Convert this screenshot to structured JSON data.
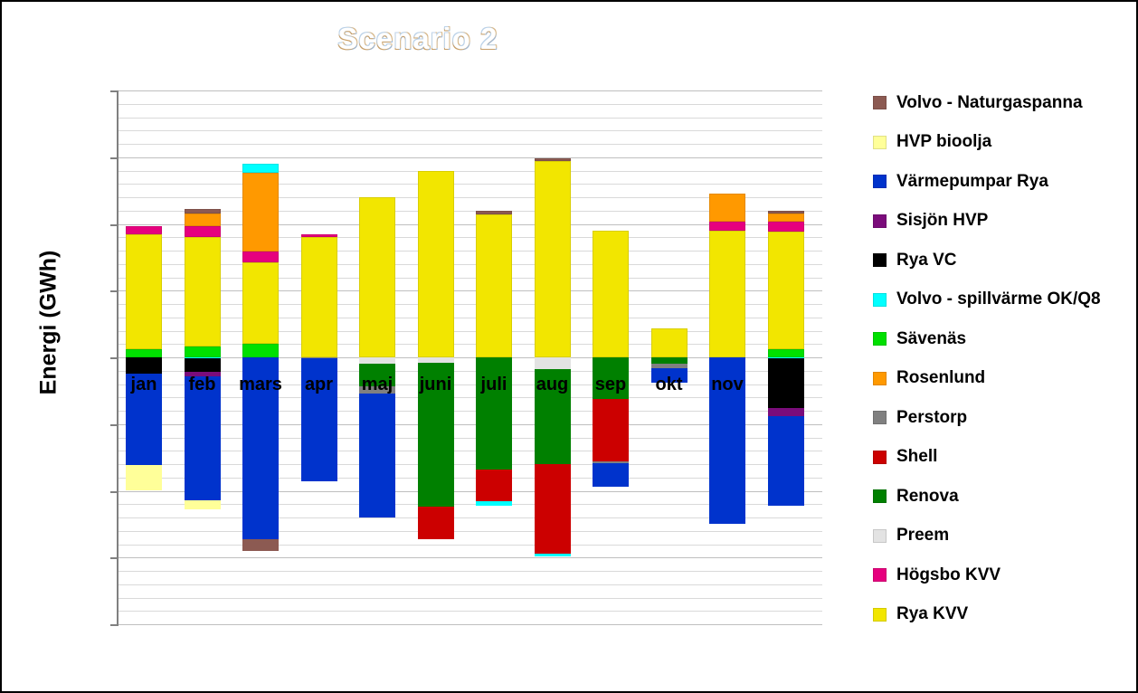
{
  "chart_data": {
    "type": "bar",
    "title": "Scenario 2",
    "xlabel": "",
    "ylabel": "Energi (GWh)",
    "ylim": [
      -200,
      200
    ],
    "ytick_step": 50,
    "minor_gridline_step": 10,
    "grid": true,
    "legend_position": "right",
    "stacked": true,
    "categories": [
      "jan",
      "feb",
      "mars",
      "apr",
      "maj",
      "juni",
      "juli",
      "aug",
      "sep",
      "okt",
      "nov",
      "dec"
    ],
    "yticks": [
      "200",
      "150",
      "100",
      "50",
      "0",
      "-50",
      "-100",
      "-150",
      "-200"
    ],
    "series": [
      {
        "name": "Volvo - Naturgaspanna",
        "color": "#8C5A52",
        "values": [
          0,
          3,
          0,
          0,
          0,
          0,
          3,
          1,
          0,
          0,
          0,
          2
        ]
      },
      {
        "name": "HVP bioolja",
        "color": "#FFFF99",
        "values": [
          -19,
          -7,
          0,
          0,
          0,
          0,
          0,
          0,
          0,
          0,
          0,
          0
        ]
      },
      {
        "name": "Värmepumpar Rya",
        "color": "#0033CC",
        "values": [
          -69,
          -68,
          -136,
          -92,
          -93,
          0,
          0,
          0,
          -18,
          -11,
          -125,
          -67
        ]
      },
      {
        "name": "Sisjön HVP",
        "color": "#7B0C7B",
        "values": [
          0,
          -3,
          0,
          0,
          0,
          0,
          0,
          0,
          0,
          0,
          0,
          -6
        ]
      },
      {
        "name": "Rya VC",
        "color": "#000000",
        "values": [
          -12,
          -10,
          0,
          0,
          0,
          0,
          0,
          0,
          0,
          0,
          0,
          -38
        ]
      },
      {
        "name": "Volvo - spillvärme OK/Q8",
        "color": "#00FFFF",
        "values": [
          0,
          -1,
          7,
          0,
          0,
          0,
          -3,
          -2,
          0,
          0,
          0,
          -1
        ]
      },
      {
        "name": "Sävenäs",
        "color": "#00E000",
        "values": [
          6,
          8,
          10,
          0,
          0,
          0,
          0,
          0,
          0,
          0,
          0,
          6
        ]
      },
      {
        "name": "Rosenlund",
        "color": "#FF9900",
        "values": [
          0,
          10,
          59,
          0,
          0,
          0,
          0,
          0,
          0,
          0,
          21,
          6
        ]
      },
      {
        "name": "Perstorp",
        "color": "#808080",
        "values": [
          0,
          0,
          0,
          -1,
          -5,
          0,
          0,
          0,
          -1,
          -3,
          0,
          0
        ]
      },
      {
        "name": "Shell",
        "color": "#CC0000",
        "values": [
          0,
          0,
          0,
          0,
          0,
          -24,
          -24,
          -67,
          -47,
          0,
          0,
          0
        ]
      },
      {
        "name": "Renova",
        "color": "#008000",
        "values": [
          0,
          0,
          0,
          0,
          -17,
          -108,
          -84,
          -71,
          -31,
          -5,
          0,
          0
        ]
      },
      {
        "name": "Preem",
        "color": "#E3E3E3",
        "values": [
          0,
          0,
          0,
          0,
          -5,
          -4,
          0,
          -9,
          0,
          0,
          0,
          0
        ]
      },
      {
        "name": "Högsbo KVV",
        "color": "#E6007E",
        "values": [
          6,
          8,
          8,
          2,
          0,
          0,
          0,
          0,
          0,
          0,
          7,
          8
        ]
      },
      {
        "name": "Rya KVV",
        "color": "#F2E600",
        "values": [
          86,
          82,
          63,
          90,
          120,
          140,
          107,
          147,
          95,
          22,
          95,
          88
        ]
      }
    ],
    "stack_order_positive": [
      [
        "Sävenäs",
        "Rya KVV",
        "Högsbo KVV",
        "Volvo - Naturgaspanna"
      ],
      [
        "Sävenäs",
        "Rya KVV",
        "Högsbo KVV",
        "Rosenlund",
        "Volvo - Naturgaspanna"
      ],
      [
        "Sävenäs",
        "Rya KVV",
        "Högsbo KVV",
        "Rosenlund",
        "Volvo - spillvärme OK/Q8"
      ],
      [
        "Rya KVV",
        "Högsbo KVV"
      ],
      [
        "Rya KVV"
      ],
      [
        "Rya KVV"
      ],
      [
        "Rya KVV",
        "Volvo - Naturgaspanna"
      ],
      [
        "Rya KVV",
        "Volvo - Naturgaspanna"
      ],
      [
        "Rya KVV"
      ],
      [
        "Rya KVV"
      ],
      [
        "Rya KVV",
        "Högsbo KVV",
        "Rosenlund"
      ],
      [
        "Sävenäs",
        "Rya KVV",
        "Högsbo KVV",
        "Rosenlund",
        "Volvo - Naturgaspanna"
      ]
    ]
  },
  "bars": [
    {
      "label": "jan",
      "x": 0,
      "pos": [
        {
          "s": "Sävenäs",
          "from": 0,
          "to": 6
        },
        {
          "s": "Rya KVV",
          "from": 6,
          "to": 92
        },
        {
          "s": "Högsbo KVV",
          "from": 92,
          "to": 98
        }
      ],
      "neg": [
        {
          "s": "Rya VC",
          "from": 0,
          "to": -12
        },
        {
          "s": "Värmepumpar Rya",
          "from": -12,
          "to": -81
        },
        {
          "s": "HVP bioolja",
          "from": -81,
          "to": -100
        }
      ]
    },
    {
      "label": "feb",
      "x": 1,
      "pos": [
        {
          "s": "Sävenäs",
          "from": 0,
          "to": 8
        },
        {
          "s": "Rya KVV",
          "from": 8,
          "to": 90
        },
        {
          "s": "Högsbo KVV",
          "from": 90,
          "to": 98
        },
        {
          "s": "Rosenlund",
          "from": 98,
          "to": 108
        },
        {
          "s": "Volvo - Naturgaspanna",
          "from": 108,
          "to": 111
        }
      ],
      "neg": [
        {
          "s": "Volvo - spillvärme OK/Q8",
          "from": 0,
          "to": -1
        },
        {
          "s": "Rya VC",
          "from": -1,
          "to": -11
        },
        {
          "s": "Sisjön HVP",
          "from": -11,
          "to": -14
        },
        {
          "s": "Värmepumpar Rya",
          "from": -14,
          "to": -107
        },
        {
          "s": "HVP bioolja",
          "from": -107,
          "to": -114
        }
      ]
    },
    {
      "label": "mars",
      "x": 2,
      "pos": [
        {
          "s": "Sävenäs",
          "from": 0,
          "to": 10
        },
        {
          "s": "Rya KVV",
          "from": 10,
          "to": 71
        },
        {
          "s": "Högsbo KVV",
          "from": 71,
          "to": 79
        },
        {
          "s": "Rosenlund",
          "from": 79,
          "to": 138
        },
        {
          "s": "Volvo - spillvärme OK/Q8",
          "from": 138,
          "to": 145
        }
      ],
      "neg": [
        {
          "s": "Värmepumpar Rya",
          "from": 0,
          "to": -136
        },
        {
          "s": "Volvo - Naturgaspanna",
          "from": -136,
          "to": -145
        }
      ]
    },
    {
      "label": "apr",
      "x": 3,
      "pos": [
        {
          "s": "Rya KVV",
          "from": 0,
          "to": 90
        },
        {
          "s": "Högsbo KVV",
          "from": 90,
          "to": 92
        }
      ],
      "neg": [
        {
          "s": "Perstorp",
          "from": 0,
          "to": -1
        },
        {
          "s": "Värmepumpar Rya",
          "from": -1,
          "to": -93
        }
      ]
    },
    {
      "label": "maj",
      "x": 4,
      "pos": [
        {
          "s": "Rya KVV",
          "from": 0,
          "to": 120
        }
      ],
      "neg": [
        {
          "s": "Preem",
          "from": 0,
          "to": -5
        },
        {
          "s": "Renova",
          "from": -5,
          "to": -22
        },
        {
          "s": "Perstorp",
          "from": -22,
          "to": -27
        },
        {
          "s": "Värmepumpar Rya",
          "from": -27,
          "to": -120
        }
      ]
    },
    {
      "label": "juni",
      "x": 5,
      "pos": [
        {
          "s": "Rya KVV",
          "from": 0,
          "to": 140
        }
      ],
      "neg": [
        {
          "s": "Preem",
          "from": 0,
          "to": -4
        },
        {
          "s": "Renova",
          "from": -4,
          "to": -112
        },
        {
          "s": "Shell",
          "from": -112,
          "to": -136
        }
      ]
    },
    {
      "label": "juli",
      "x": 6,
      "pos": [
        {
          "s": "Rya KVV",
          "from": 0,
          "to": 107
        },
        {
          "s": "Volvo - Naturgaspanna",
          "from": 107,
          "to": 110
        }
      ],
      "neg": [
        {
          "s": "Renova",
          "from": 0,
          "to": -84
        },
        {
          "s": "Shell",
          "from": -84,
          "to": -108
        },
        {
          "s": "Volvo - spillvärme OK/Q8",
          "from": -108,
          "to": -111
        }
      ]
    },
    {
      "label": "aug",
      "x": 7,
      "pos": [
        {
          "s": "Rya KVV",
          "from": 0,
          "to": 147
        },
        {
          "s": "Volvo - Naturgaspanna",
          "from": 147,
          "to": 149
        }
      ],
      "neg": [
        {
          "s": "Preem",
          "from": 0,
          "to": -9
        },
        {
          "s": "Renova",
          "from": -9,
          "to": -80
        },
        {
          "s": "Shell",
          "from": -80,
          "to": -147
        },
        {
          "s": "Volvo - spillvärme OK/Q8",
          "from": -147,
          "to": -149
        }
      ]
    },
    {
      "label": "sep",
      "x": 8,
      "pos": [
        {
          "s": "Rya KVV",
          "from": 0,
          "to": 95
        }
      ],
      "neg": [
        {
          "s": "Renova",
          "from": 0,
          "to": -31
        },
        {
          "s": "Shell",
          "from": -31,
          "to": -78
        },
        {
          "s": "Perstorp",
          "from": -78,
          "to": -79
        },
        {
          "s": "Värmepumpar Rya",
          "from": -79,
          "to": -97
        }
      ]
    },
    {
      "label": "okt",
      "x": 9,
      "pos": [
        {
          "s": "Rya KVV",
          "from": 0,
          "to": 22
        }
      ],
      "neg": [
        {
          "s": "Renova",
          "from": 0,
          "to": -5
        },
        {
          "s": "Perstorp",
          "from": -5,
          "to": -8
        },
        {
          "s": "Värmepumpar Rya",
          "from": -8,
          "to": -19
        }
      ]
    },
    {
      "label": "nov",
      "x": 10,
      "pos": [
        {
          "s": "Rya KVV",
          "from": 0,
          "to": 95
        },
        {
          "s": "Högsbo KVV",
          "from": 95,
          "to": 102
        },
        {
          "s": "Rosenlund",
          "from": 102,
          "to": 123
        }
      ],
      "neg": [
        {
          "s": "Värmepumpar Rya",
          "from": 0,
          "to": -125
        }
      ]
    },
    {
      "label": "dec",
      "x": 11,
      "pos": [
        {
          "s": "Sävenäs",
          "from": 0,
          "to": 6
        },
        {
          "s": "Rya KVV",
          "from": 6,
          "to": 94
        },
        {
          "s": "Högsbo KVV",
          "from": 94,
          "to": 102
        },
        {
          "s": "Rosenlund",
          "from": 102,
          "to": 108
        },
        {
          "s": "Volvo - Naturgaspanna",
          "from": 108,
          "to": 110
        }
      ],
      "neg": [
        {
          "s": "Volvo - spillvärme OK/Q8",
          "from": 0,
          "to": -1
        },
        {
          "s": "Rya VC",
          "from": -1,
          "to": -38
        },
        {
          "s": "Sisjön HVP",
          "from": -38,
          "to": -44
        },
        {
          "s": "Värmepumpar Rya",
          "from": -44,
          "to": -111
        }
      ]
    }
  ],
  "legend": {
    "items": [
      {
        "label": "Volvo - Naturgaspanna",
        "color": "#8C5A52"
      },
      {
        "label": "HVP bioolja",
        "color": "#FFFF99"
      },
      {
        "label": "Värmepumpar Rya",
        "color": "#0033CC"
      },
      {
        "label": "Sisjön HVP",
        "color": "#7B0C7B"
      },
      {
        "label": "Rya VC",
        "color": "#000000"
      },
      {
        "label": "Volvo - spillvärme OK/Q8",
        "color": "#00FFFF"
      },
      {
        "label": "Sävenäs",
        "color": "#00E000"
      },
      {
        "label": "Rosenlund",
        "color": "#FF9900"
      },
      {
        "label": "Perstorp",
        "color": "#808080"
      },
      {
        "label": "Shell",
        "color": "#CC0000"
      },
      {
        "label": "Renova",
        "color": "#008000"
      },
      {
        "label": "Preem",
        "color": "#E3E3E3"
      },
      {
        "label": "Högsbo KVV",
        "color": "#E6007E"
      },
      {
        "label": "Rya KVV",
        "color": "#F2E600"
      }
    ]
  }
}
